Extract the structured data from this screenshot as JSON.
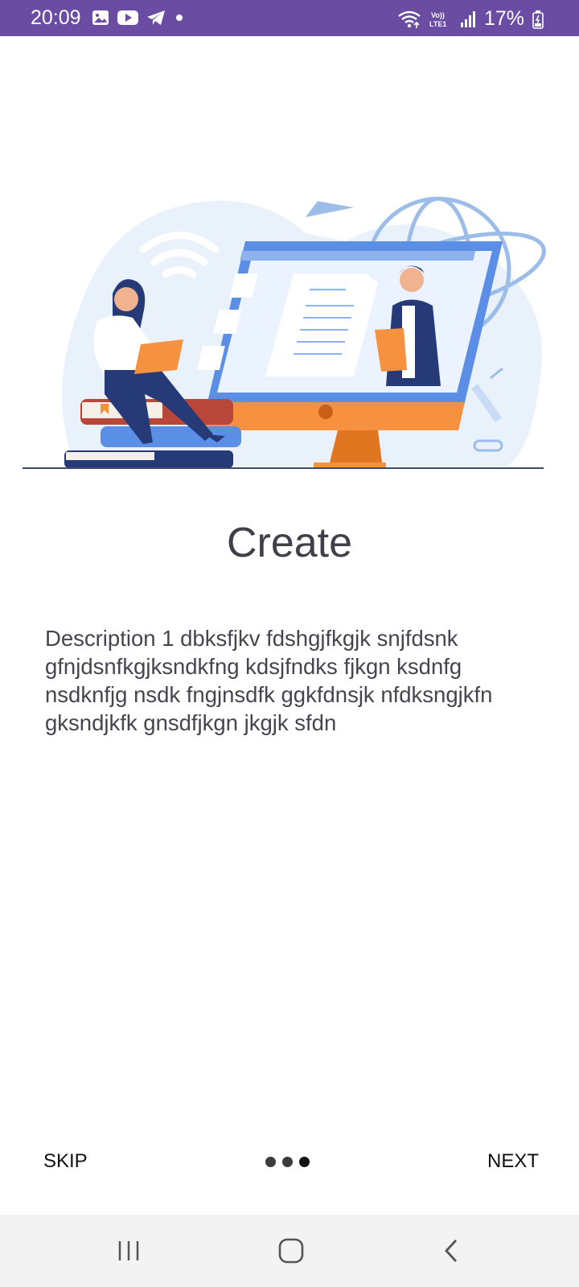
{
  "status_bar": {
    "time": "20:09",
    "battery_text": "17%",
    "left_icons": [
      "gallery-icon",
      "youtube-icon",
      "telegram-icon",
      "dot-icon"
    ],
    "right_icons": [
      "wifi-icon",
      "volte-icon",
      "signal-icon",
      "battery-icon"
    ]
  },
  "illustration": {
    "name": "woman-laptop-teacher-monitor-illustration",
    "colors": {
      "accent_orange": "#f5913f",
      "accent_blue": "#5b8fe6",
      "navy": "#263a78",
      "background_blob": "#e9f1fb"
    }
  },
  "content": {
    "title": "Create",
    "description": "Description 1 dbksfjkv fdshgjfkgjk snjfdsnk gfnjdsnfkgjksndkfng kdsjfndks fjkgn ksdnfg nsdknfjg nsdk fngjnsdfk ggkfdnsjk nfdksngjkfn gksndjkfk gnsdfjkgn jkgjk sfdn"
  },
  "controls": {
    "skip_label": "SKIP",
    "next_label": "NEXT",
    "pages": 3
  },
  "nav_bar": {
    "buttons": [
      "recent-apps-icon",
      "home-icon",
      "back-icon"
    ]
  }
}
